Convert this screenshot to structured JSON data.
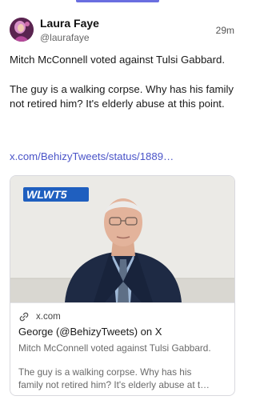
{
  "post": {
    "author": {
      "display_name": "Laura Faye",
      "handle": "@laurafaye"
    },
    "timestamp": "29m",
    "text": {
      "paragraph_1": "Mitch McConnell voted against Tulsi Gabbard.",
      "paragraph_2": "The guy is a walking corpse. Why has his family not retired him? It's elderly abuse at this point."
    },
    "link_text": "x.com/BehizyTweets/status/1889…"
  },
  "link_card": {
    "media_logo": "WLWT5",
    "domain": "x.com",
    "title": "George (@BehizyTweets) on X",
    "description": "Mitch McConnell voted against Tulsi Gabbard.",
    "description_line_1": "The guy is a walking corpse. Why has his",
    "description_line_2": "family not retired him? It's elderly abuse at t…"
  },
  "colors": {
    "link": "#4a54c8",
    "accent": "#6a6ee0",
    "logo_bg": "#1f5fbf"
  },
  "icons": [
    "avatar-photo",
    "link-icon"
  ]
}
